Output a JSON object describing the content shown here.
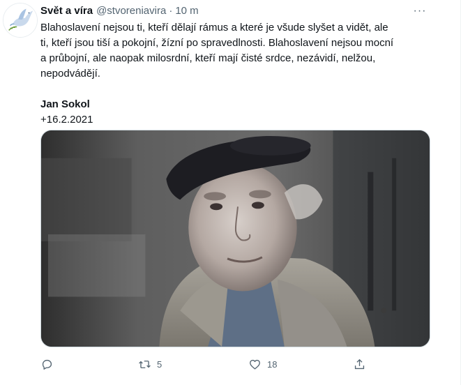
{
  "tweet": {
    "author": {
      "display_name": "Svět a víra",
      "handle": "@stvoreniavira",
      "separator": "·",
      "time": "10 m",
      "avatar_icon": "dove-icon"
    },
    "more_label": "···",
    "text_lines": [
      "Blahoslavení nejsou ti, kteří dělají rámus a které je všude slyšet a vidět, ale",
      "ti, kteří jsou tiší a pokojní, žízní po spravedlnosti. Blahoslavení nejsou mocní",
      "a průbojní, ale naopak milosrdní, kteří mají čisté srdce, nezávidí, nelžou,",
      "nepodvádějí."
    ],
    "signature_name": "Jan Sokol",
    "signature_date": "+16.2.2021",
    "media_description_icon": "portrait-photo",
    "actions": {
      "reply_icon": "reply-icon",
      "retweet_icon": "retweet-icon",
      "retweet_count": "5",
      "like_icon": "heart-icon",
      "like_count": "18",
      "share_icon": "share-icon"
    },
    "colors": {
      "text": "#0f1419",
      "secondary": "#536471",
      "border": "#cfd9de"
    }
  }
}
